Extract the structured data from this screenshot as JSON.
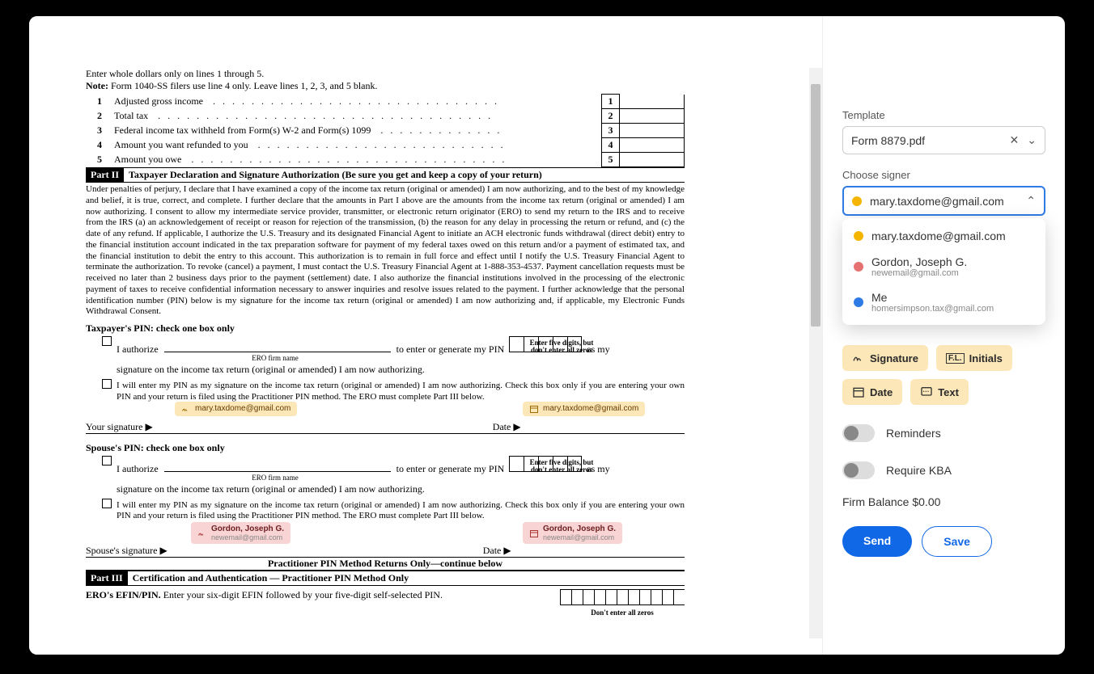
{
  "document": {
    "header_line": "Enter whole dollars only on lines 1 through 5.",
    "note": "Note: Form 1040-SS filers use line 4 only. Leave lines 1, 2, 3, and 5 blank.",
    "rows": [
      {
        "n": "1",
        "label": "Adjusted gross income"
      },
      {
        "n": "2",
        "label": "Total tax"
      },
      {
        "n": "3",
        "label": "Federal income tax withheld from Form(s) W-2 and Form(s) 1099"
      },
      {
        "n": "4",
        "label": "Amount you want refunded to you"
      },
      {
        "n": "5",
        "label": "Amount you owe"
      }
    ],
    "part2_label": "Part II",
    "part2_title": "Taxpayer Declaration and Signature Authorization (Be sure you get and keep a copy of your return)",
    "declaration": "Under penalties of perjury, I declare that I have examined a copy of the income tax return (original or amended) I am now authorizing, and to the best of my knowledge and belief, it is true, correct, and complete. I further declare that the amounts in Part I above are the amounts from the income tax return (original or amended) I am now authorizing. I consent to allow my intermediate service provider, transmitter, or electronic return originator (ERO) to send my return to the IRS and to receive from the IRS (a) an acknowledgement of receipt or reason for rejection of the transmission, (b) the reason for any delay in processing the return or refund, and (c) the date of any refund. If applicable, I authorize the U.S. Treasury and its designated Financial Agent to initiate an ACH electronic funds withdrawal (direct debit) entry to the financial institution account indicated in the tax preparation software for payment of my federal taxes owed on this return and/or a payment of estimated tax, and the financial institution to debit the entry to this account. This authorization is to remain in full force and effect until I notify the U.S. Treasury Financial Agent to terminate the authorization. To revoke (cancel) a payment, I must contact the U.S. Treasury Financial Agent at 1-888-353-4537. Payment cancellation requests must be received no later than 2 business days prior to the payment (settlement) date. I also authorize the financial institutions involved in the processing of the electronic payment of taxes to receive confidential information necessary to answer inquiries and resolve issues related to the payment. I further acknowledge that the personal identification number (PIN) below is my signature for the income tax return (original or amended) I am now authorizing and, if applicable, my Electronic Funds Withdrawal Consent.",
    "taxpayer_pin_hdr": "Taxpayer's PIN: check one box only",
    "auth_prefix": "I authorize",
    "ero_firm": "ERO firm name",
    "pin_suffix": "to enter or generate my PIN",
    "pin_hint_top": "Enter five digits, but",
    "pin_hint_bot": "don't enter all zeros",
    "as_my": "as my",
    "sig_line": "signature on the income tax return (original or amended) I am now authorizing.",
    "self_enter": "I will enter my PIN as my signature on the income tax return (original or amended) I am now authorizing. Check this box only if you are entering your own PIN and your return is filed using the Practitioner PIN method. The ERO must complete Part III below.",
    "your_sig": "Your signature ▶",
    "date_lbl": "Date ▶",
    "spouse_hdr": "Spouse's PIN: check one box only",
    "spouse_sig": "Spouse's signature ▶",
    "pract_hdr": "Practitioner PIN Method Returns Only—continue below",
    "part3_label": "Part III",
    "part3_title": "Certification and Authentication — Practitioner PIN Method Only",
    "ero_efin": "ERO's EFIN/PIN. Enter your six-digit EFIN followed by your five-digit self-selected PIN.",
    "dont_zeros": "Don't enter all zeros"
  },
  "tags": {
    "mary": "mary.taxdome@gmail.com",
    "gordon_name": "Gordon, Joseph G.",
    "gordon_email": "newemail@gmail.com"
  },
  "panel": {
    "template_label": "Template",
    "template_value": "Form 8879.pdf",
    "choose_signer": "Choose signer",
    "selected_signer": "mary.taxdome@gmail.com",
    "options": [
      {
        "color": "y",
        "name": "mary.taxdome@gmail.com",
        "email": ""
      },
      {
        "color": "r",
        "name": "Gordon, Joseph G.",
        "email": "newemail@gmail.com"
      },
      {
        "color": "b",
        "name": "Me",
        "email": "homersimpson.tax@gmail.com"
      }
    ],
    "fields": {
      "signature": "Signature",
      "initials": "Initials",
      "date": "Date",
      "text": "Text"
    },
    "reminders": "Reminders",
    "kba": "Require KBA",
    "firm": "Firm Balance $0.00",
    "send": "Send",
    "save": "Save"
  }
}
